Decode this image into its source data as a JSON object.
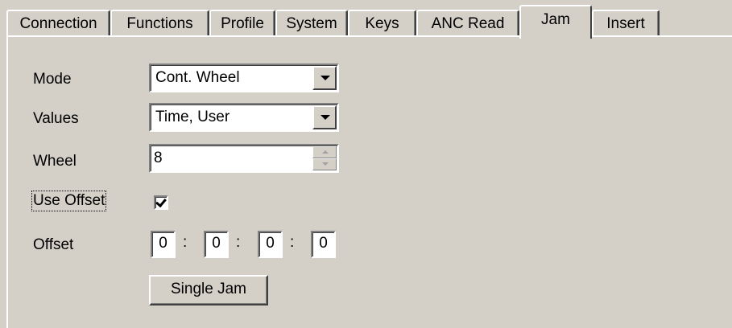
{
  "tabs": [
    {
      "label": "Connection",
      "active": false
    },
    {
      "label": "Functions",
      "active": false
    },
    {
      "label": "Profile",
      "active": false
    },
    {
      "label": "System",
      "active": false
    },
    {
      "label": "Keys",
      "active": false
    },
    {
      "label": "ANC Read",
      "active": false
    },
    {
      "label": "Jam",
      "active": true
    },
    {
      "label": "Insert",
      "active": false
    }
  ],
  "form": {
    "mode_label": "Mode",
    "mode_value": "Cont. Wheel",
    "values_label": "Values",
    "values_value": "Time, User",
    "wheel_label": "Wheel",
    "wheel_value": "8",
    "use_offset_label": "Use Offset",
    "use_offset_checked": true,
    "offset_label": "Offset",
    "offset_fields": [
      "0",
      "0",
      "0",
      "0"
    ],
    "offset_separator": ":",
    "single_jam_label": "Single Jam"
  },
  "colors": {
    "background": "#d4d0c8",
    "field": "#ffffff"
  }
}
